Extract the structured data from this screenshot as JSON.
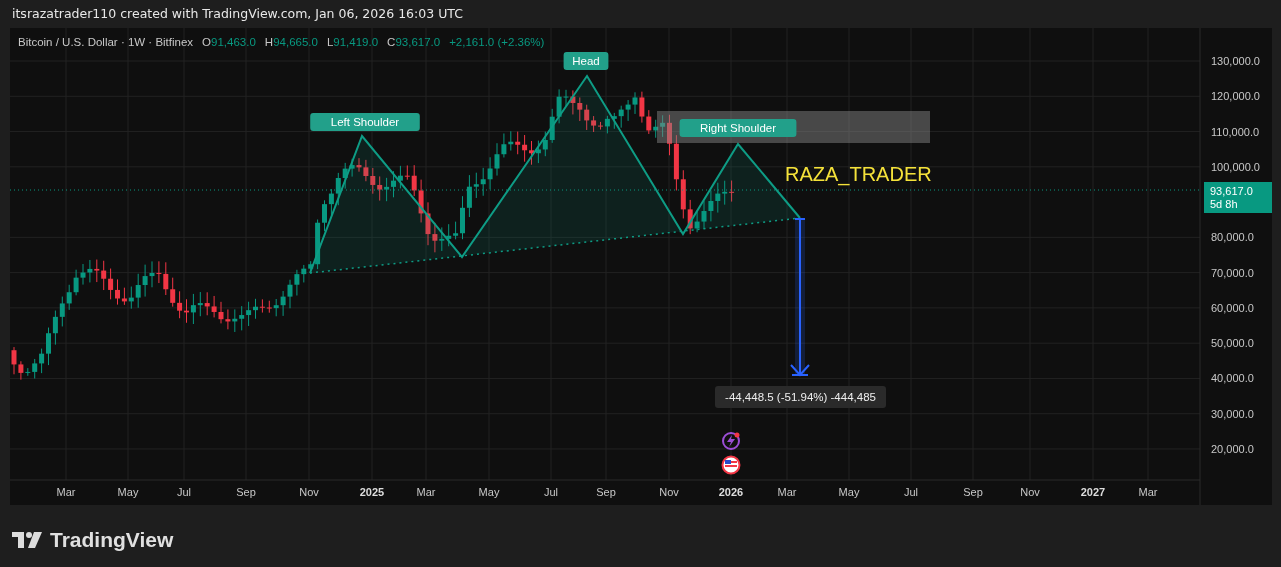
{
  "header": {
    "attribution": "itsrazatrader110 created with TradingView.com, Jan 06, 2026 16:03 UTC"
  },
  "legend": {
    "symbol": "Bitcoin / U.S. Dollar · 1W · Bitfinex",
    "ohlc": [
      {
        "label": "O",
        "value": "91,463.0"
      },
      {
        "label": "H",
        "value": "94,665.0"
      },
      {
        "label": "L",
        "value": "91,419.0"
      },
      {
        "label": "C",
        "value": "93,617.0"
      }
    ],
    "change": "+2,161.0 (+2.36%)"
  },
  "price_axis": [
    "130,000.0",
    "120,000.0",
    "110,000.0",
    "100,000.0",
    "80,000.0",
    "70,000.0",
    "60,000.0",
    "50,000.0",
    "40,000.0",
    "30,000.0",
    "20,000.0"
  ],
  "last_price": {
    "value": "93,617.0",
    "countdown": "5d 8h"
  },
  "time_axis": [
    {
      "label": "Mar",
      "kind": "month"
    },
    {
      "label": "May",
      "kind": "month"
    },
    {
      "label": "Jul",
      "kind": "month"
    },
    {
      "label": "Sep",
      "kind": "month"
    },
    {
      "label": "Nov",
      "kind": "month"
    },
    {
      "label": "2025",
      "kind": "year"
    },
    {
      "label": "Mar",
      "kind": "month"
    },
    {
      "label": "May",
      "kind": "month"
    },
    {
      "label": "Jul",
      "kind": "month"
    },
    {
      "label": "Sep",
      "kind": "month"
    },
    {
      "label": "Nov",
      "kind": "month"
    },
    {
      "label": "2026",
      "kind": "year"
    },
    {
      "label": "Mar",
      "kind": "month"
    },
    {
      "label": "May",
      "kind": "month"
    },
    {
      "label": "Jul",
      "kind": "month"
    },
    {
      "label": "Sep",
      "kind": "month"
    },
    {
      "label": "Nov",
      "kind": "month"
    },
    {
      "label": "2027",
      "kind": "year"
    },
    {
      "label": "Mar",
      "kind": "month"
    }
  ],
  "pattern_labels": [
    "Left Shoulder",
    "Head",
    "Right Shoulder"
  ],
  "chart_text": "RAZA_TRADER",
  "measure_label": "-44,448.5 (-51.94%) -444,485",
  "footer": {
    "logo": "TradingView"
  }
}
